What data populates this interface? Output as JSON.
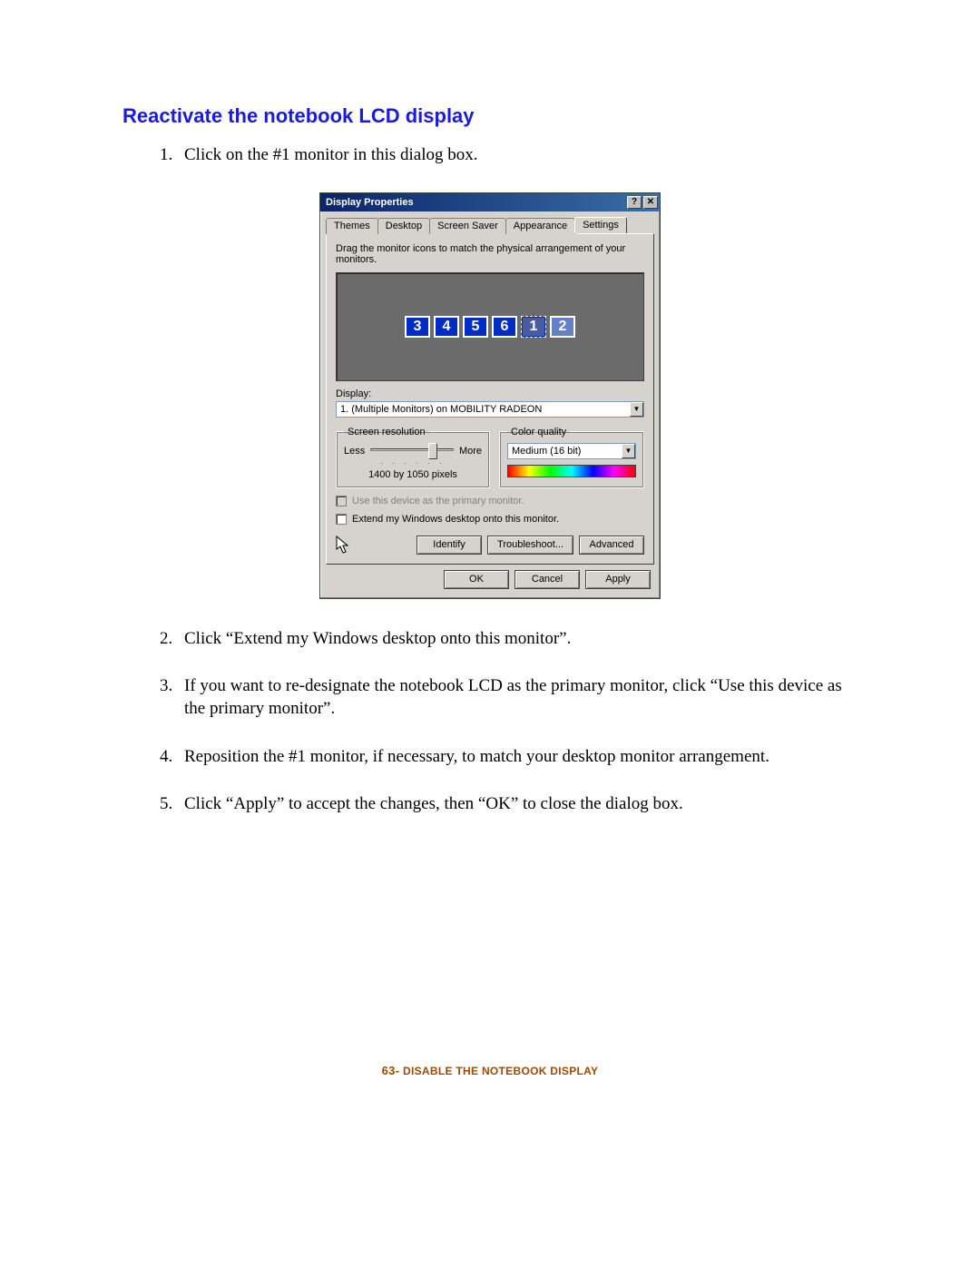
{
  "heading": "Reactivate the notebook LCD display",
  "steps": [
    "Click on the #1 monitor in this dialog box.",
    "Click “Extend my Windows desktop onto this monitor”.",
    "If you want to re-designate the notebook LCD as the primary monitor, click “Use this device as the primary monitor”.",
    "Reposition the #1 monitor, if necessary, to match your desktop monitor arrangement.",
    "Click “Apply” to accept the changes, then “OK” to close the dialog box."
  ],
  "dialog": {
    "title": "Display Properties",
    "help_btn": "?",
    "close_btn": "✕",
    "tabs": {
      "themes": "Themes",
      "desktop": "Desktop",
      "screensaver": "Screen Saver",
      "appearance": "Appearance",
      "settings": "Settings"
    },
    "instruction": "Drag the monitor icons to match the physical arrangement of your monitors.",
    "monitors": [
      "3",
      "4",
      "5",
      "6",
      "1",
      "2"
    ],
    "display_label": "Display:",
    "display_value": "1. (Multiple Monitors) on MOBILITY RADEON",
    "res_group": "Screen resolution",
    "res_less": "Less",
    "res_more": "More",
    "res_value": "1400 by 1050 pixels",
    "color_group": "Color quality",
    "color_value": "Medium (16 bit)",
    "chk_primary": "Use this device as the primary monitor.",
    "chk_extend": "Extend my Windows desktop onto this monitor.",
    "btn_identify": "Identify",
    "btn_troubleshoot": "Troubleshoot...",
    "btn_advanced": "Advanced",
    "btn_ok": "OK",
    "btn_cancel": "Cancel",
    "btn_apply": "Apply"
  },
  "footer": {
    "page": "63-",
    "first": "D",
    "rest": "ISABLE THE NOTEBOOK DISPLAY"
  }
}
